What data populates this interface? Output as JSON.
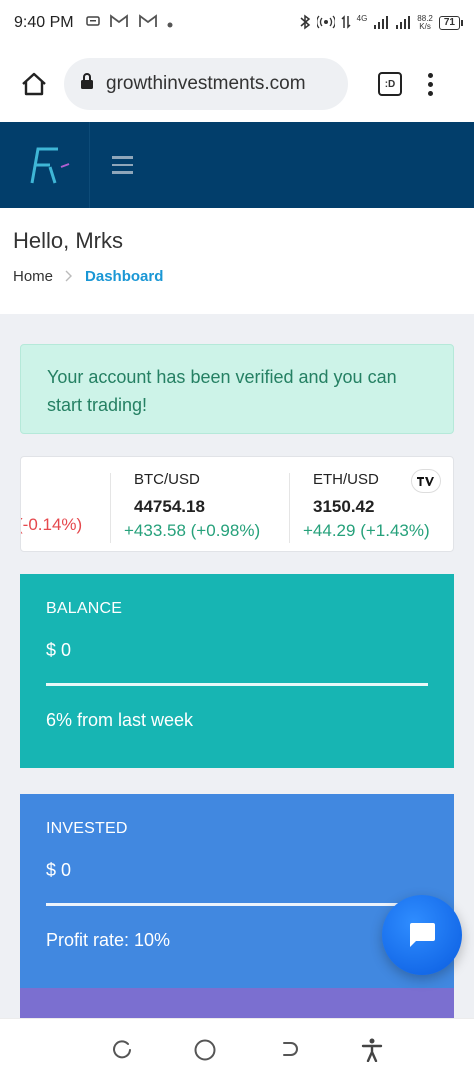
{
  "status_bar": {
    "time": "9:40 PM",
    "network": "4G",
    "speed_value": "88.2",
    "speed_unit": "K/s",
    "battery": "71"
  },
  "browser": {
    "url": "growthinvestments.com",
    "tabs_label": ":D"
  },
  "header": {
    "logo_text": "F"
  },
  "page": {
    "greeting": "Hello, Mrks",
    "breadcrumb": {
      "home": "Home",
      "current": "Dashboard"
    }
  },
  "alert": {
    "message": "Your account has been verified and you can start trading!"
  },
  "ticker": {
    "partial_change": "(-0.14%)",
    "items": [
      {
        "symbol": "BTC/USD",
        "price": "44754.18",
        "change": "+433.58 (+0.98%)"
      },
      {
        "symbol": "ETH/USD",
        "price": "3150.42",
        "change": "+44.29 (+1.43%)"
      }
    ],
    "widget_logo": "TV"
  },
  "cards": {
    "balance": {
      "label": "BALANCE",
      "value": "$ 0",
      "footer": "6% from last week"
    },
    "invested": {
      "label": "INVESTED",
      "value": "$ 0",
      "footer": "Profit rate: 10%"
    }
  },
  "colors": {
    "header_bg": "#023e6b",
    "balance_bg": "#17b5b3",
    "invested_bg": "#4188e0",
    "alert_bg": "#cdf3e8",
    "positive": "#26a17b",
    "negative": "#e5484d",
    "link": "#1a97d5"
  },
  "icons": {
    "home": "home-icon",
    "lock": "lock-icon",
    "menu": "more-vert-icon",
    "hamburger": "hamburger-icon",
    "chat": "chat-icon",
    "nav": [
      "recents-icon",
      "home-circle-icon",
      "back-icon",
      "accessibility-icon"
    ]
  }
}
